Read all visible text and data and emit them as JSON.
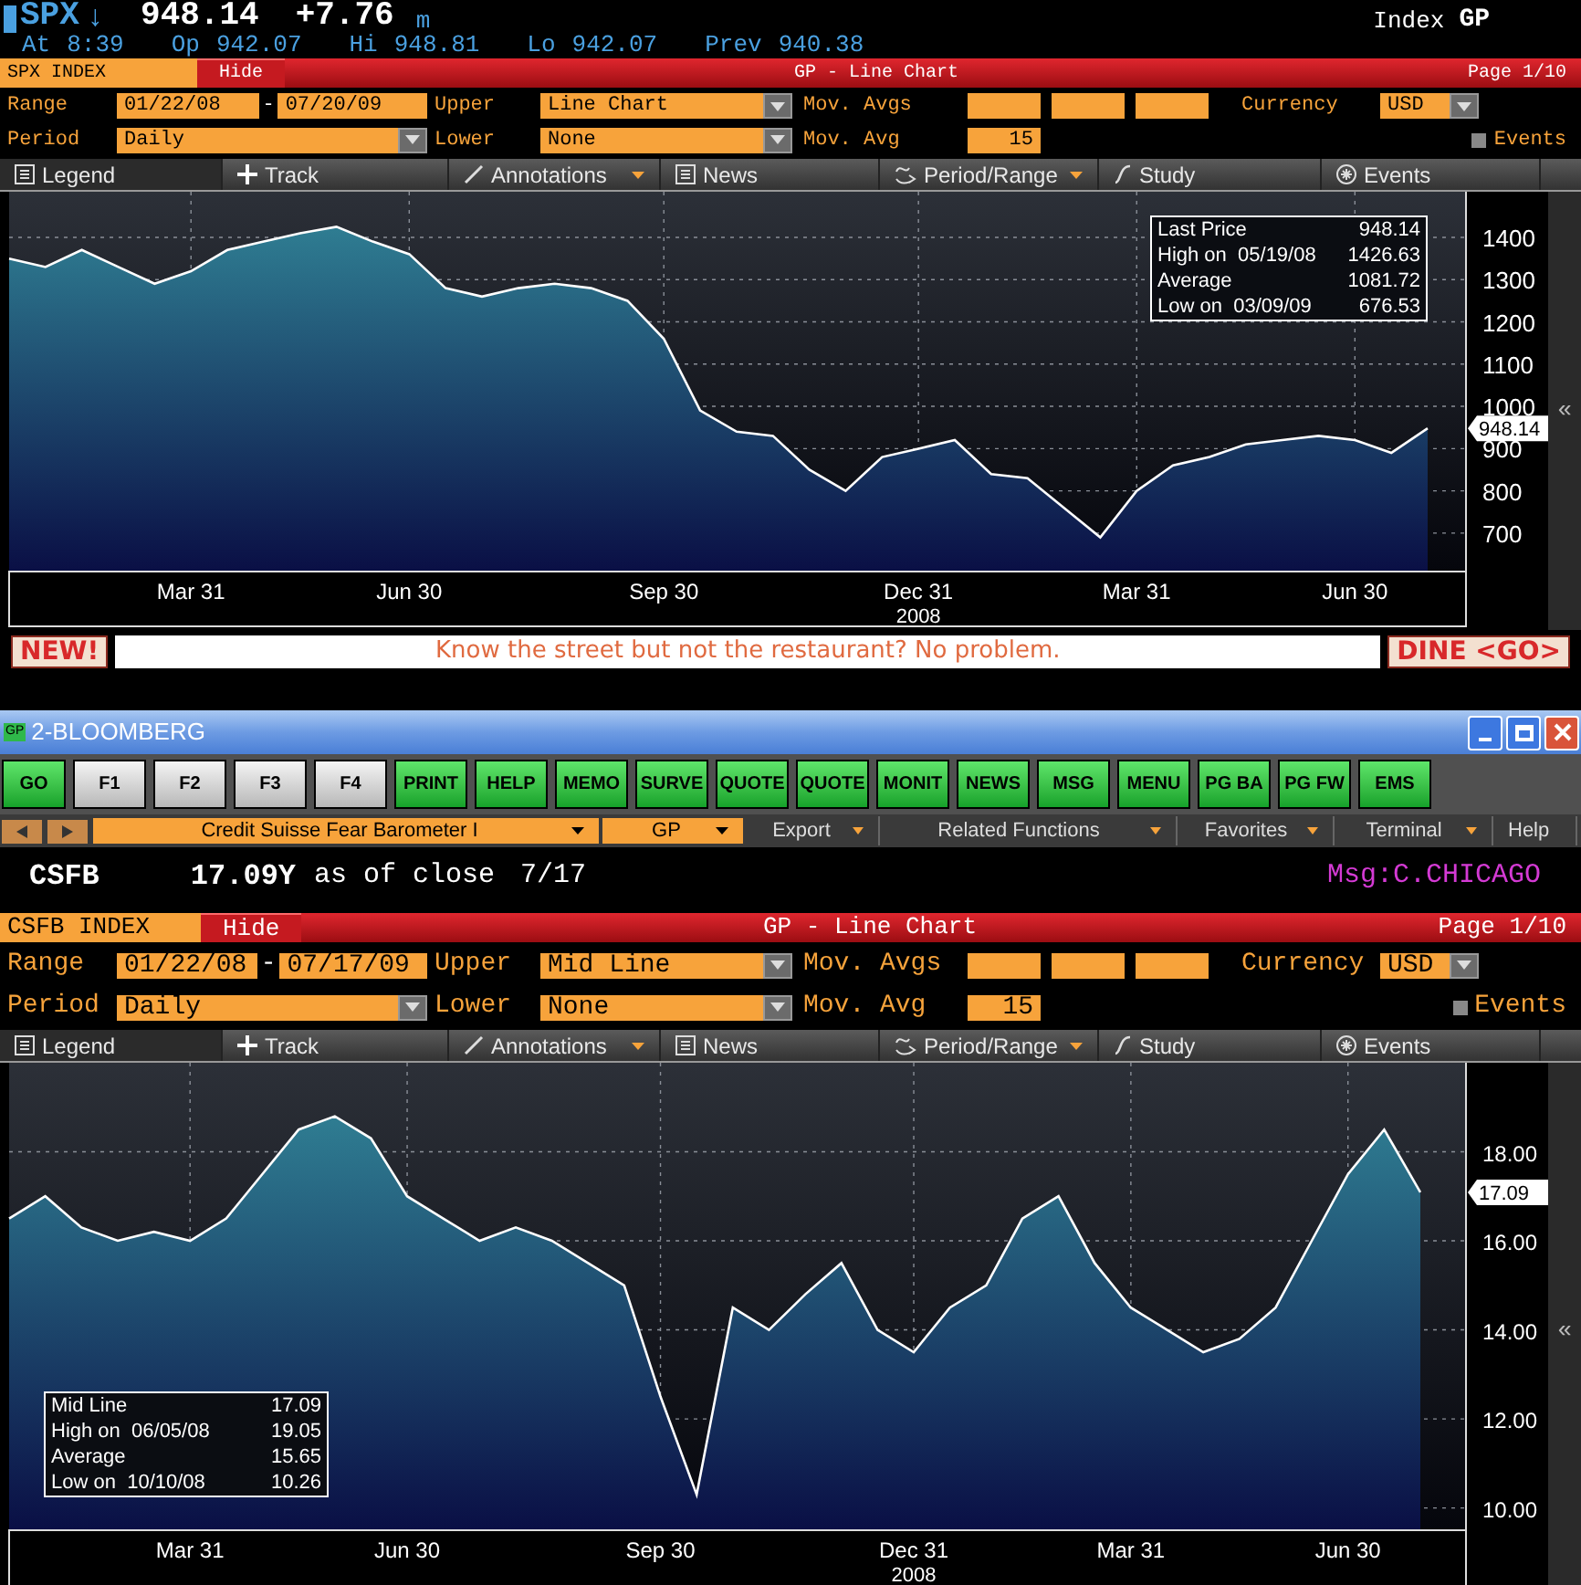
{
  "quote": {
    "ticker": "SPX",
    "arrow": "↓",
    "price": "948.14",
    "change": "+7.76",
    "flag": "m",
    "type": "Index",
    "function": "GP",
    "details": [
      {
        "label": "At",
        "value": "8:39"
      },
      {
        "label": "Op",
        "value": "942.07"
      },
      {
        "label": "Hi",
        "value": "948.81"
      },
      {
        "label": "Lo",
        "value": "942.07"
      },
      {
        "label": "Prev",
        "value": "940.38"
      }
    ]
  },
  "panels": [
    {
      "security": "SPX INDEX",
      "hide": "Hide",
      "title": "GP - Line Chart",
      "page": "Page 1/10",
      "form": {
        "range_label": "Range",
        "start": "01/22/08",
        "dash": "-",
        "end": "07/20/09",
        "upper_label": "Upper",
        "upper": "Line Chart",
        "mov_avgs_label": "Mov. Avgs",
        "currency_label": "Currency",
        "currency": "USD",
        "period_label": "Period",
        "period": "Daily",
        "lower_label": "Lower",
        "lower": "None",
        "mov_avg_label": "Mov. Avg",
        "mov_avg": "15",
        "events": "Events",
        "events_checked": false
      },
      "toolbar": [
        {
          "label": "Legend",
          "selected": true,
          "menu": false
        },
        {
          "label": "Track",
          "selected": false,
          "menu": false
        },
        {
          "label": "Annotations",
          "selected": false,
          "menu": true
        },
        {
          "label": "News",
          "selected": false,
          "menu": false
        },
        {
          "label": "Period/Range",
          "selected": false,
          "menu": true
        },
        {
          "label": "Study",
          "selected": false,
          "menu": false
        },
        {
          "label": "Events",
          "selected": false,
          "menu": false
        }
      ],
      "legend": [
        {
          "value": "948.14"
        },
        {
          "label": "High on  05/19/08",
          "value": "1426.63"
        },
        {
          "label": "Average",
          "value": "1081.72"
        },
        {
          "label": "Low on  03/09/09",
          "value": "676.53"
        }
      ],
      "price_tag": "948.14",
      "collapse": "«",
      "chart_data": {
        "type": "area",
        "xlabel": "2008",
        "categories": [
          null,
          null,
          null,
          null,
          null,
          "Mar 31",
          null,
          null,
          null,
          null,
          null,
          "Jun 30",
          null,
          null,
          null,
          null,
          null,
          null,
          "Sep 30",
          null,
          null,
          null,
          null,
          null,
          null,
          "Dec 31",
          null,
          null,
          null,
          null,
          null,
          "Mar 31",
          null,
          null,
          null,
          null,
          null,
          "Jun 30",
          null,
          null
        ],
        "series": [
          {
            "name": "Last Price",
            "color": "#ffffff",
            "values": [
              1350,
              1330,
              1370,
              1330,
              1290,
              1320,
              1370,
              1390,
              1410,
              1425,
              1390,
              1360,
              1280,
              1260,
              1280,
              1290,
              1280,
              1250,
              1160,
              990,
              940,
              930,
              850,
              800,
              880,
              900,
              920,
              840,
              830,
              760,
              690,
              800,
              860,
              880,
              910,
              920,
              930,
              920,
              890,
              948
            ]
          }
        ],
        "ylim": [
          609,
          1508
        ],
        "grid": true,
        "yticks": [
          700,
          800,
          900,
          1000,
          1100,
          1200,
          1300,
          1400
        ]
      }
    },
    {
      "security": "CSFB INDEX",
      "hide": "Hide",
      "title": "GP - Line Chart",
      "page": "Page 1/10",
      "form": {
        "range_label": "Range",
        "start": "01/22/08",
        "dash": "-",
        "end": "07/17/09",
        "upper_label": "Upper",
        "upper": "Mid Line",
        "mov_avgs_label": "Mov. Avgs",
        "currency_label": "Currency",
        "currency": "USD",
        "period_label": "Period",
        "period": "Daily",
        "lower_label": "Lower",
        "lower": "None",
        "mov_avg_label": "Mov. Avg",
        "mov_avg": "15",
        "events": "Events",
        "events_checked": false
      },
      "toolbar": [
        {
          "label": "Legend",
          "selected": true,
          "menu": false
        },
        {
          "label": "Track",
          "selected": false,
          "menu": false
        },
        {
          "label": "Annotations",
          "selected": false,
          "menu": true
        },
        {
          "label": "News",
          "selected": false,
          "menu": false
        },
        {
          "label": "Period/Range",
          "selected": false,
          "menu": true
        },
        {
          "label": "Study",
          "selected": false,
          "menu": false
        },
        {
          "label": "Events",
          "selected": false,
          "menu": false
        }
      ],
      "legend": [
        {
          "value": "17.09"
        },
        {
          "label": "High on  06/05/08",
          "value": "19.05"
        },
        {
          "label": "Average",
          "value": "15.65"
        },
        {
          "label": "Low on  10/10/08",
          "value": "10.26"
        }
      ],
      "price_tag": "17.09",
      "collapse": "«",
      "chart_data": {
        "type": "area",
        "xlabel": "2008",
        "categories": [
          null,
          null,
          null,
          null,
          null,
          "Mar 31",
          null,
          null,
          null,
          null,
          null,
          "Jun 30",
          null,
          null,
          null,
          null,
          null,
          null,
          "Sep 30",
          null,
          null,
          null,
          null,
          null,
          null,
          "Dec 31",
          null,
          null,
          null,
          null,
          null,
          "Mar 31",
          null,
          null,
          null,
          null,
          null,
          "Jun 30",
          null,
          null
        ],
        "series": [
          {
            "name": "Mid Line",
            "color": "#ffffff",
            "values": [
              16.5,
              17.0,
              16.3,
              16.0,
              16.2,
              16.0,
              16.5,
              17.5,
              18.5,
              18.8,
              18.3,
              17.0,
              16.5,
              16.0,
              16.3,
              16.0,
              15.5,
              15.0,
              12.5,
              10.3,
              14.5,
              14.0,
              14.8,
              15.5,
              14.0,
              13.5,
              14.5,
              15.0,
              16.5,
              17.0,
              15.5,
              14.5,
              14.0,
              13.5,
              13.8,
              14.5,
              16.0,
              17.5,
              18.5,
              17.09
            ]
          }
        ],
        "ylim": [
          9.5,
          20
        ],
        "grid": true,
        "yticks": [
          {
            "value": 10,
            "label": "10.00"
          },
          {
            "value": 12,
            "label": "12.00"
          },
          {
            "value": 14,
            "label": "14.00"
          },
          {
            "value": 16,
            "label": "16.00"
          },
          {
            "value": 18,
            "label": "18.00"
          }
        ]
      }
    }
  ],
  "ad": {
    "badge": "NEW!",
    "text": "Know the street but not the restaurant? No problem.",
    "action": "DINE <GO>"
  },
  "window": {
    "icon_text": "GP",
    "title": "2-BLOOMBERG"
  },
  "buttons": [
    {
      "label": "GO",
      "kind": "green"
    },
    {
      "label": "F1",
      "kind": "gray"
    },
    {
      "label": "F2",
      "kind": "gray"
    },
    {
      "label": "F3",
      "kind": "gray"
    },
    {
      "label": "F4",
      "kind": "gray"
    },
    {
      "label": "PRINT",
      "kind": "green"
    },
    {
      "label": "HELP",
      "kind": "green"
    },
    {
      "label": "MEMO",
      "kind": "green"
    },
    {
      "label": "SURVE",
      "kind": "green"
    },
    {
      "label": "QUOTE",
      "kind": "green"
    },
    {
      "label": "QUOTE",
      "kind": "green"
    },
    {
      "label": "MONIT",
      "kind": "green"
    },
    {
      "label": "NEWS",
      "kind": "green"
    },
    {
      "label": "MSG",
      "kind": "green"
    },
    {
      "label": "MENU",
      "kind": "green"
    },
    {
      "label": "PG BA",
      "kind": "green"
    },
    {
      "label": "PG FW",
      "kind": "green"
    },
    {
      "label": "EMS",
      "kind": "green"
    }
  ],
  "nav": {
    "security": "Credit Suisse Fear Barometer I",
    "function": "GP",
    "menus": [
      {
        "label": "Export",
        "menu": true
      },
      {
        "label": "Related Functions",
        "menu": true
      },
      {
        "label": "Favorites",
        "menu": true
      },
      {
        "label": "Terminal",
        "menu": true
      },
      {
        "label": "Help",
        "menu": false
      }
    ]
  },
  "status": {
    "ticker": "CSFB",
    "price": "17.09Y",
    "note": "as of close",
    "date": "7/17",
    "message": "Msg:C.CHICAGO"
  }
}
